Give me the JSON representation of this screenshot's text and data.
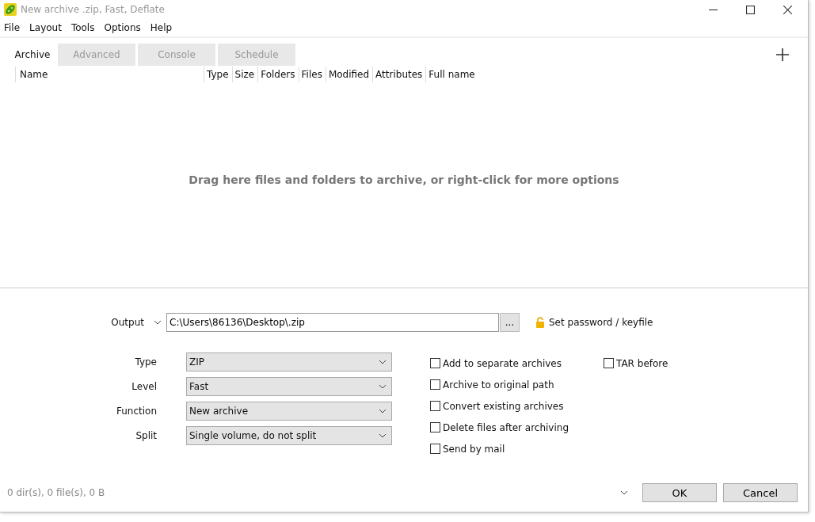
{
  "window": {
    "title": "New archive .zip, Fast, Deflate"
  },
  "menu": [
    "File",
    "Layout",
    "Tools",
    "Options",
    "Help"
  ],
  "tabs": [
    {
      "label": "Archive",
      "selected": true
    },
    {
      "label": "Advanced",
      "selected": false
    },
    {
      "label": "Console",
      "selected": false
    },
    {
      "label": "Schedule",
      "selected": false
    }
  ],
  "table": {
    "columns": [
      "Name",
      "Type",
      "Size",
      "Folders",
      "Files",
      "Modified",
      "Attributes",
      "Full name"
    ],
    "empty_hint": "Drag here files and folders to archive, or right-click for more options"
  },
  "output": {
    "label": "Output",
    "value": "C:\\Users\\86136\\Desktop\\.zip",
    "browse": "...",
    "password": "Set password / keyfile"
  },
  "fields": [
    {
      "label": "Type",
      "value": "ZIP"
    },
    {
      "label": "Level",
      "value": "Fast"
    },
    {
      "label": "Function",
      "value": "New archive"
    },
    {
      "label": "Split",
      "value": "Single volume, do not split"
    }
  ],
  "options": [
    {
      "label": "Add to separate archives",
      "checked": false
    },
    {
      "label": "Archive to original path",
      "checked": false
    },
    {
      "label": "Convert existing archives",
      "checked": false
    },
    {
      "label": "Delete files after archiving",
      "checked": false
    },
    {
      "label": "Send by mail",
      "checked": false
    }
  ],
  "tar_before": {
    "label": "TAR before",
    "checked": false
  },
  "status": "0 dir(s), 0 file(s), 0 B",
  "buttons": [
    "OK",
    "Cancel"
  ]
}
